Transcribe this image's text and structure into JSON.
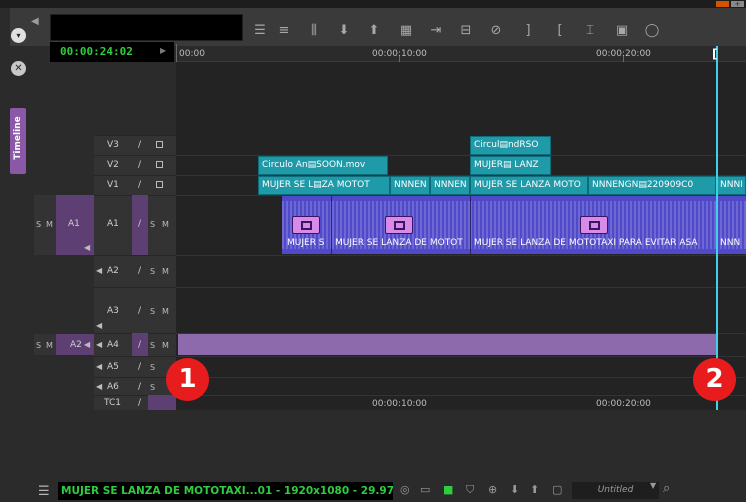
{
  "window": {
    "minimize_label": "–",
    "add_label": "+"
  },
  "toolbar": {
    "menu_icon": "▾",
    "close_icon": "✕",
    "timecode": "00:00:24:02",
    "play_icon": "▶",
    "rev_icon": "◀",
    "buttons": [
      "menu-lines-icon",
      "sliders-icon",
      "align-icon",
      "arrow-down-icon",
      "arrow-up-icon",
      "film-icon",
      "insert-icon",
      "overwrite-icon",
      "no-icon",
      "bracket-close-icon",
      "bracket-open-icon",
      "split-icon",
      "ripple-icon",
      "circle-icon"
    ]
  },
  "side_tab": {
    "label": "Timeline"
  },
  "ruler": {
    "t0": "00:00",
    "t1": "00:00:10:00",
    "t2": "00:00:20:00"
  },
  "tracks": {
    "v3": "V3",
    "v2": "V2",
    "v1": "V1",
    "a1_src": "A1",
    "a1": "A1",
    "a2": "A2",
    "a3": "A3",
    "a2_src": "A2",
    "a4": "A4",
    "a5": "A5",
    "a6": "A6",
    "tc1": "TC1",
    "s": "S",
    "m": "M",
    "pen": "/",
    "speaker": "◀"
  },
  "clips": {
    "v3_1": "Circul▤ndRSO",
    "v2_1": "Circulo An▤SOON.mov",
    "v2_2": "MUJER▤ LANZ",
    "v1_1": "MUJER SE L▤ZA MOTOT",
    "v1_2": "NNNEN",
    "v1_3": "NNNEN",
    "v1_4": "MUJER SE LANZA MOTO",
    "v1_5": "NNNENGN▤220909C0",
    "v1_6": "NNNI"
  },
  "audio_labels": {
    "a1_1": "MUJER S",
    "a1_2": "MUJER SE LANZA DE MOTOT",
    "a1_3": "MUJER SE LANZA DE MOTOTAXI PARA EVITAR ASA",
    "a1_4": "NNN"
  },
  "markers": {
    "m1": "1",
    "m2": "2"
  },
  "status": {
    "clip_info": "MUJER SE LANZA DE MOTOTAXI...01 - 1920x1080 - 29.97 fps",
    "preset": "Untitled",
    "menu_icon": "☰"
  },
  "colors": {
    "accent_purple": "#8b58a8",
    "clip_teal": "#1f9aa8",
    "audio_blue": "#5049c9",
    "timecode_green": "#2fcc40",
    "playhead": "#3fd0ea",
    "marker_red": "#e81c1c"
  }
}
